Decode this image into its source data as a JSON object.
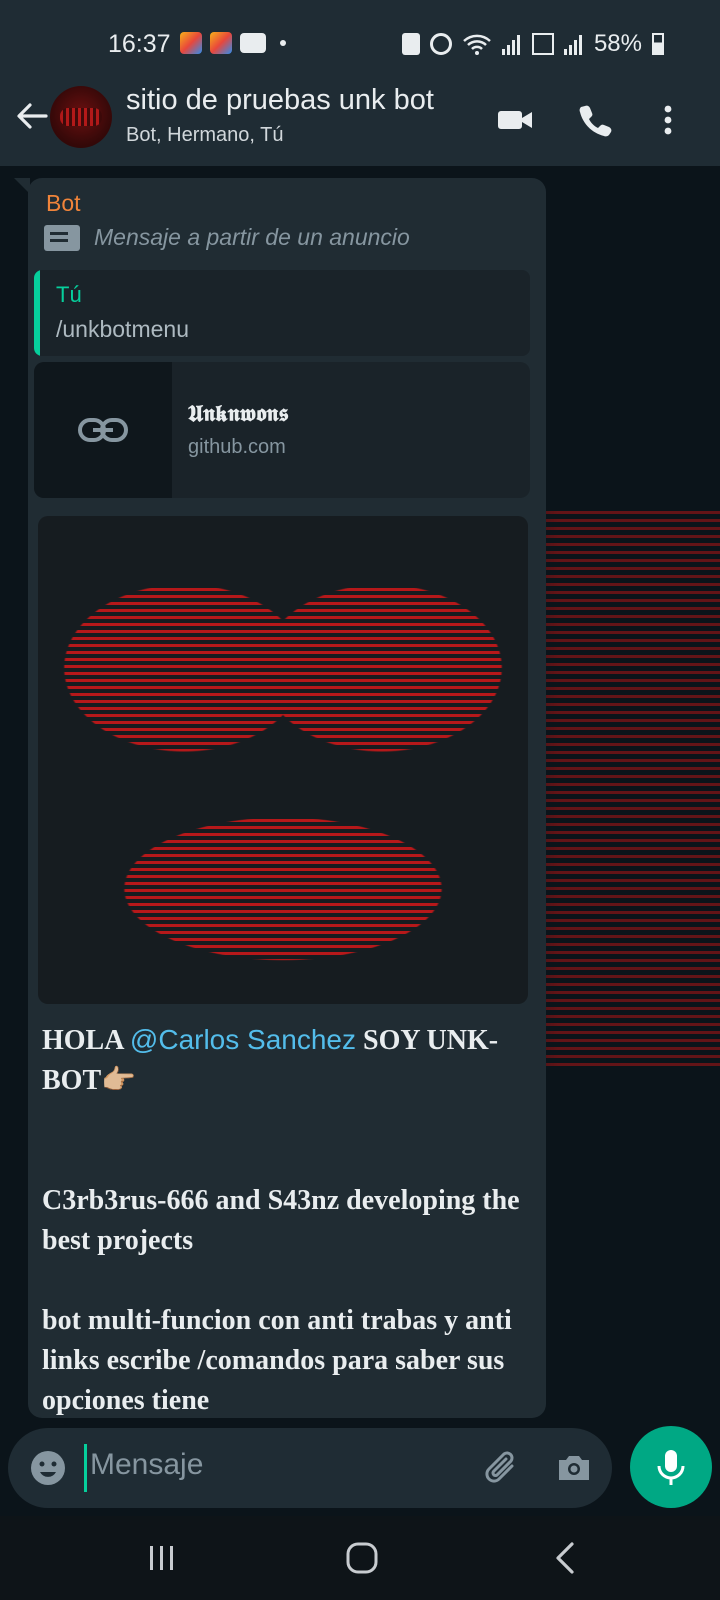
{
  "status_bar": {
    "time": "16:37",
    "battery": "58%"
  },
  "header": {
    "title": "sitio de pruebas unk bot",
    "subtitle": "Bot, Hermano, Tú"
  },
  "message": {
    "sender": "Bot",
    "ad_note": "Mensaje a partir de un anuncio",
    "quote": {
      "author": "Tú",
      "text": "/unkbotmenu"
    },
    "link_preview": {
      "title": "𝖀𝖓𝖐𝖓𝖜𝖔𝖓𝖘",
      "domain": "github.com"
    },
    "body": {
      "greeting_prefix": "HOLA ",
      "mention": "@Carlos Sanchez",
      "greeting_suffix": " SOY UNK-BOT👉🏼",
      "line2": "C3rb3rus-666 and S43nz developing the best projects",
      "line3": "bot multi-funcion con anti trabas y anti links escribe /comandos para saber sus opciones tiene"
    }
  },
  "composer": {
    "placeholder": "Mensaje"
  },
  "colors": {
    "accent": "#00a884",
    "sender": "#f0843a",
    "mention": "#53bdeb",
    "quote_bar": "#06cf9c"
  }
}
